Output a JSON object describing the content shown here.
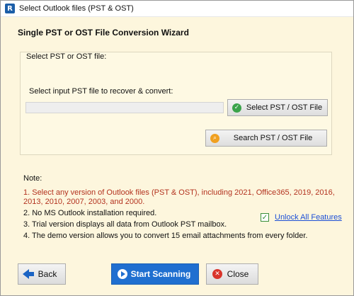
{
  "window": {
    "title": "Select Outlook files (PST & OST)",
    "app_icon_letter": "R"
  },
  "wizard": {
    "title": "Single PST or OST File Conversion Wizard"
  },
  "group": {
    "label": "Select PST or OST file:",
    "input_label": "Select input PST file to recover & convert:",
    "path_value": "",
    "select_button": "Select PST / OST File",
    "search_button": "Search PST / OST File"
  },
  "notes": {
    "heading": "Note:",
    "items": [
      "1. Select any version of Outlook files (PST & OST), including 2021, Office365, 2019, 2016, 2013, 2010, 2007, 2003, and 2000.",
      "2. No MS Outlook installation required.",
      "3. Trial version displays all data from Outlook PST mailbox.",
      "4. The demo version allows you to convert 15 email attachments from every folder."
    ]
  },
  "unlock": {
    "label": "Unlock All Features",
    "checked": true
  },
  "footer": {
    "back": "Back",
    "start": "Start Scanning",
    "close": "Close"
  },
  "colors": {
    "background": "#fdf6dd",
    "note_red": "#b3321f",
    "link_blue": "#1c4fd6",
    "primary_button": "#1f6fd0"
  },
  "icons": {
    "app": "app-logo-icon",
    "select": "green-check-icon",
    "search": "search-icon",
    "back": "arrow-left-icon",
    "start": "play-icon",
    "close": "close-x-icon"
  }
}
